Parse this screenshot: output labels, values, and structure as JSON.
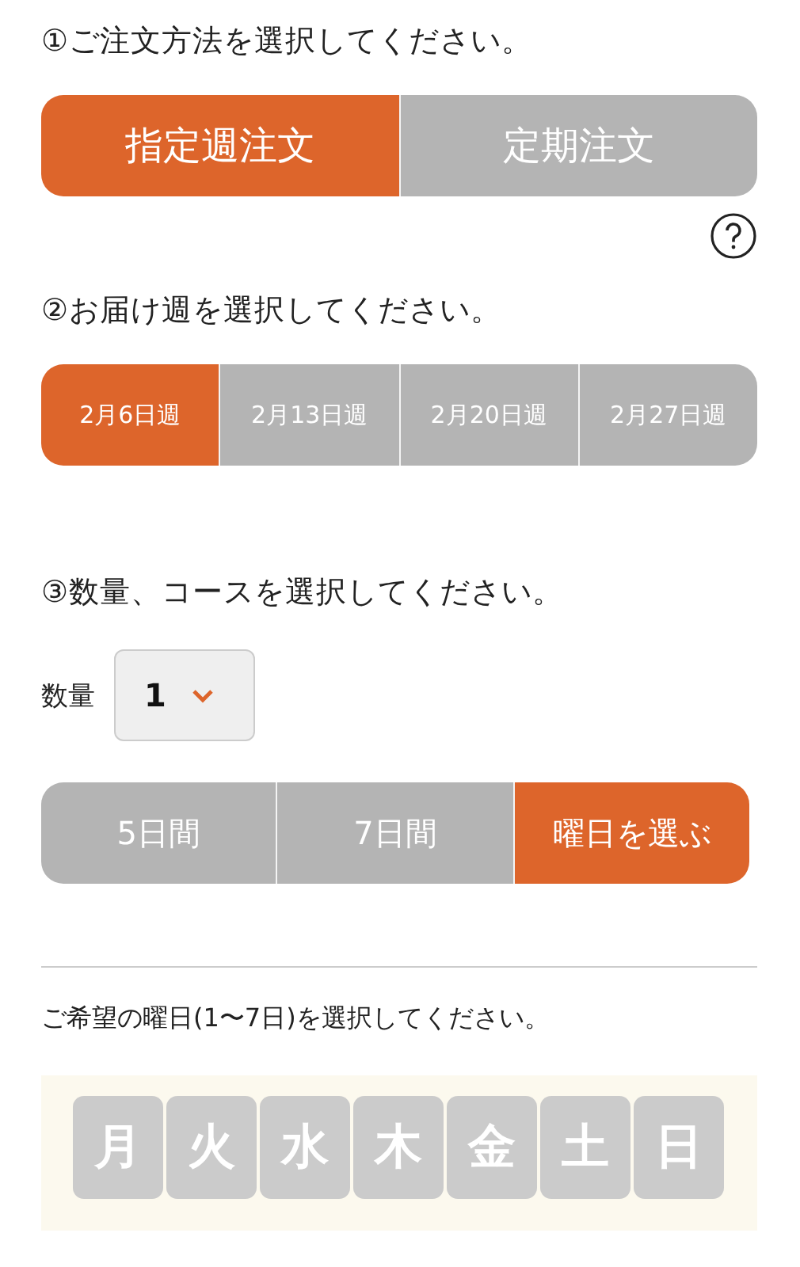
{
  "step1": {
    "heading": "①ご注文方法を選択してください。",
    "options": [
      {
        "label": "指定週注文",
        "selected": true
      },
      {
        "label": "定期注文",
        "selected": false
      }
    ]
  },
  "step2": {
    "heading": "②お届け週を選択してください。",
    "weeks": [
      {
        "label": "2月6日週",
        "selected": true
      },
      {
        "label": "2月13日週",
        "selected": false
      },
      {
        "label": "2月20日週",
        "selected": false
      },
      {
        "label": "2月27日週",
        "selected": false
      }
    ]
  },
  "step3": {
    "heading": "③数量、コースを選択してください。",
    "quantity": {
      "label": "数量",
      "value": "1"
    },
    "courses": [
      {
        "label": "5日間",
        "selected": false
      },
      {
        "label": "7日間",
        "selected": false
      },
      {
        "label": "曜日を選ぶ",
        "selected": true
      }
    ]
  },
  "weekday_prompt": "ご希望の曜日(1〜7日)を選択してください。",
  "weekdays": [
    {
      "label": "月",
      "selected": false
    },
    {
      "label": "火",
      "selected": false
    },
    {
      "label": "水",
      "selected": false
    },
    {
      "label": "木",
      "selected": false
    },
    {
      "label": "金",
      "selected": false
    },
    {
      "label": "土",
      "selected": false
    },
    {
      "label": "日",
      "selected": false
    }
  ]
}
